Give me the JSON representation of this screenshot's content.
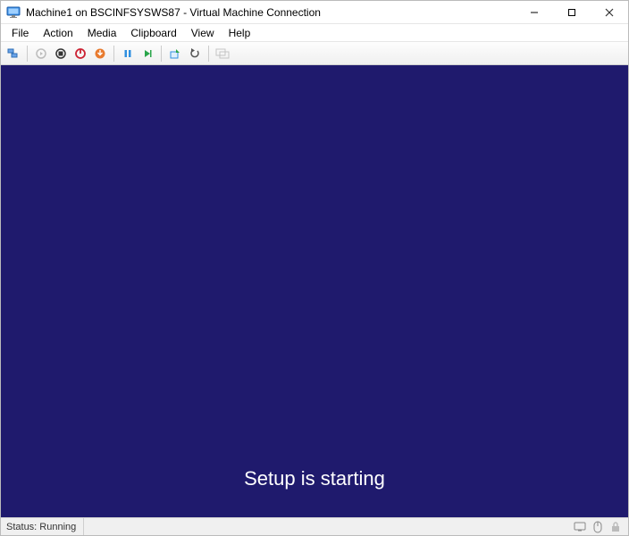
{
  "window": {
    "title": "Machine1 on BSCINFSYSWS87 - Virtual Machine Connection"
  },
  "menu": {
    "items": [
      "File",
      "Action",
      "Media",
      "Clipboard",
      "View",
      "Help"
    ]
  },
  "toolbar": {
    "buttons": [
      {
        "name": "ctrl-alt-del-button",
        "icon": "ctrlaltdel-icon"
      },
      {
        "name": "start-button",
        "icon": "start-icon",
        "disabled": true
      },
      {
        "name": "turnoff-button",
        "icon": "turnoff-icon"
      },
      {
        "name": "shutdown-button",
        "icon": "shutdown-icon"
      },
      {
        "name": "save-button",
        "icon": "save-icon"
      },
      {
        "name": "pause-button",
        "icon": "pause-icon"
      },
      {
        "name": "reset-button",
        "icon": "reset-icon"
      },
      {
        "name": "checkpoint-button",
        "icon": "checkpoint-icon"
      },
      {
        "name": "revert-button",
        "icon": "revert-icon"
      },
      {
        "name": "enhanced-session-button",
        "icon": "enhanced-icon",
        "disabled": true
      }
    ]
  },
  "vm": {
    "setup_message": "Setup is starting"
  },
  "status": {
    "text": "Status: Running"
  },
  "colors": {
    "vm_bg": "#1f1a6d"
  }
}
